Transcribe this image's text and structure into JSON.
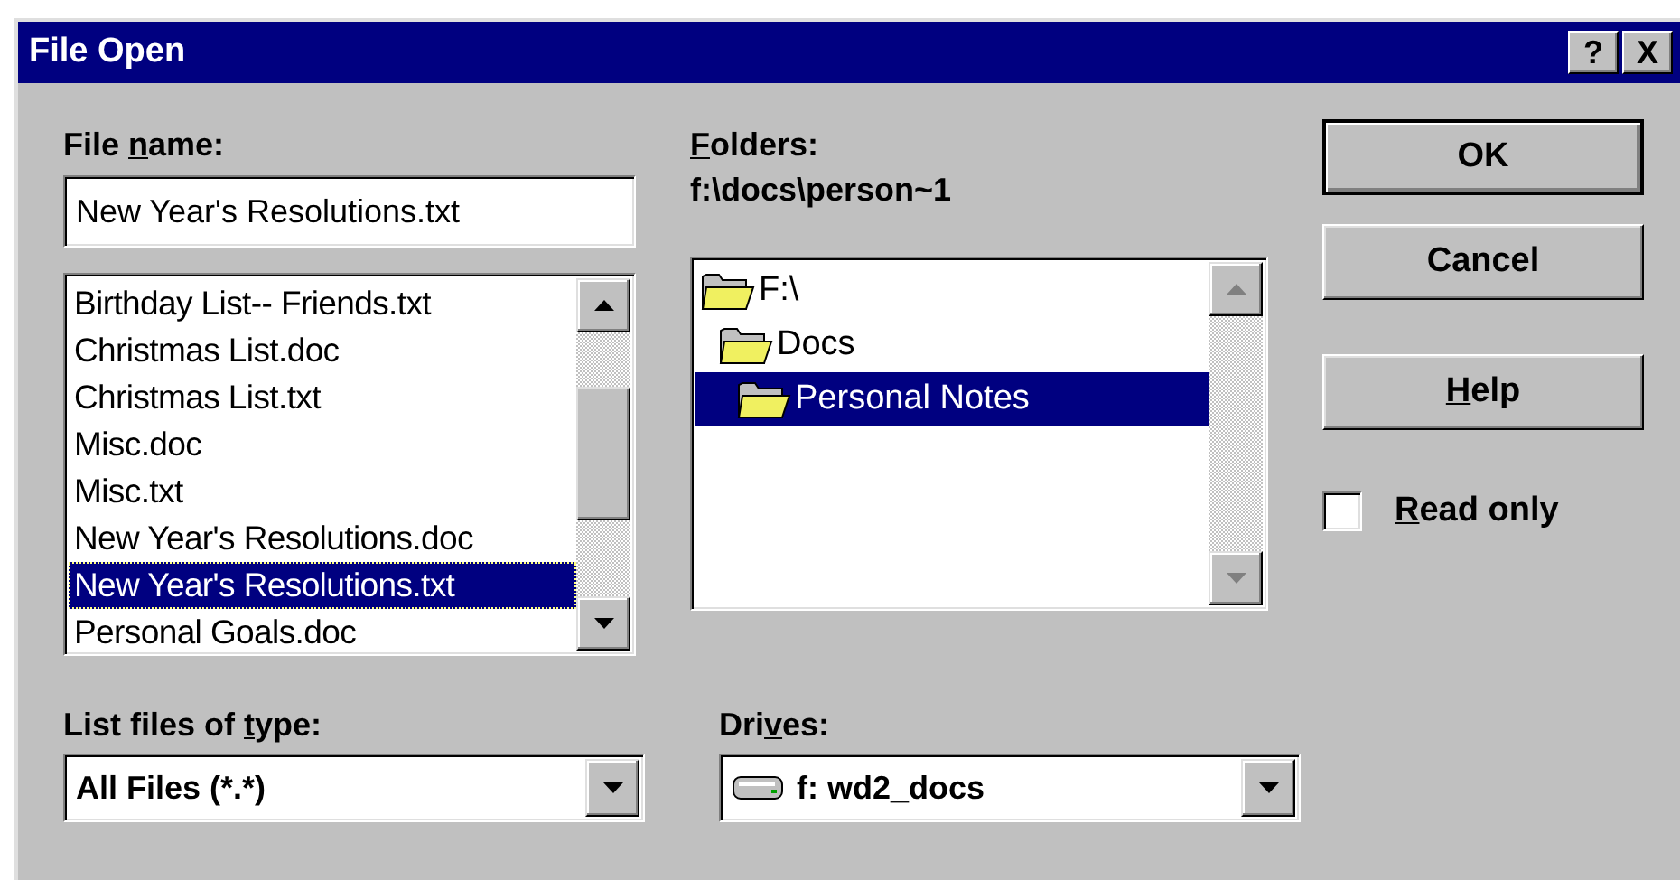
{
  "window": {
    "title": "File Open",
    "buttons": [
      {
        "label": "?"
      },
      {
        "label": "X"
      }
    ]
  },
  "file_name": {
    "label": {
      "pre": "File ",
      "key": "n",
      "post": "ame:"
    },
    "value": "New Year's Resolutions.txt"
  },
  "files": [
    {
      "name": "Birthday List-- Friends.txt",
      "selected": false
    },
    {
      "name": "Christmas List.doc",
      "selected": false
    },
    {
      "name": "Christmas List.txt",
      "selected": false
    },
    {
      "name": "Misc.doc",
      "selected": false
    },
    {
      "name": "Misc.txt",
      "selected": false
    },
    {
      "name": "New Year's Resolutions.doc",
      "selected": false
    },
    {
      "name": "New Year's Resolutions.txt",
      "selected": true
    },
    {
      "name": "Personal Goals.doc",
      "selected": false
    }
  ],
  "folders": {
    "label": {
      "key": "F",
      "post": "olders:"
    },
    "path": "f:\\docs\\person~1",
    "items": [
      {
        "name": "F:\\",
        "selected": false,
        "children": [
          {
            "name": "Docs",
            "selected": false,
            "children": [
              {
                "name": "Personal Notes",
                "selected": true
              }
            ]
          }
        ]
      }
    ]
  },
  "buttons": [
    {
      "label": {
        "post": "OK"
      },
      "default": true
    },
    {
      "label": {
        "post": "Cancel"
      },
      "default": false
    },
    {
      "label": {
        "key": "H",
        "post": "elp"
      },
      "default": false
    }
  ],
  "read_only": {
    "label": {
      "key": "R",
      "post": "ead only"
    },
    "checked": false
  },
  "file_type": {
    "label": {
      "pre": "List files of ",
      "key": "t",
      "post": "ype:"
    },
    "value": "All Files (*.*)"
  },
  "drives": {
    "label": {
      "pre": "Dri",
      "key": "v",
      "post": "es:"
    },
    "value": "f: wd2_docs"
  }
}
